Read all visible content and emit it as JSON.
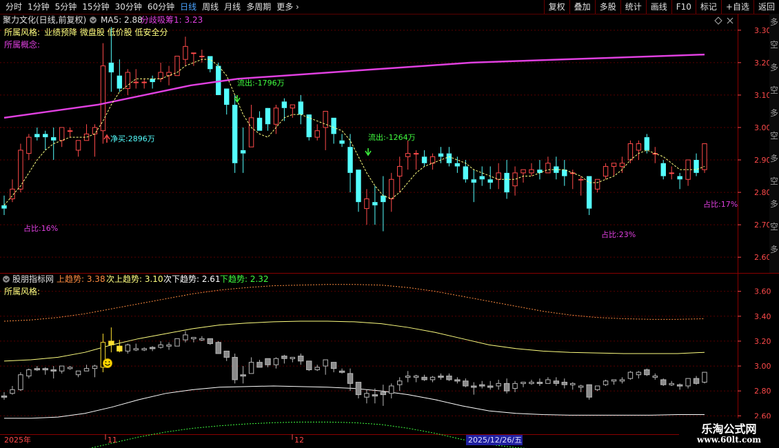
{
  "toolbar": {
    "periods": [
      "分时",
      "1分钟",
      "5分钟",
      "15分钟",
      "30分钟",
      "60分钟",
      "日线",
      "周线",
      "月线",
      "多周期",
      "更多"
    ],
    "active_period": "日线",
    "buttons": [
      "复权",
      "叠加",
      "多股",
      "统计",
      "画线",
      "F10",
      "标记",
      "+自选",
      "返回"
    ]
  },
  "main_panel": {
    "title": "聚力文化(日线,前复权)",
    "ma_label": "MA5: 2.88",
    "ind_label": "分歧吸筹1: 3.23",
    "style_label": "所属风格:",
    "style_value": "业绩预降 微盘股 低价股 低安全分",
    "concept_label": "所属概念:",
    "annotations": {
      "flow_out_1": "流出:-1796万",
      "flow_out_2": "流出:-1264万",
      "net_buy": "净买:2896万",
      "share_1": "占比:16%",
      "share_2": "占比:23%",
      "share_3": "占比:17%"
    },
    "y_ticks": [
      "3.30",
      "3.20",
      "3.10",
      "3.00",
      "2.90",
      "2.80",
      "2.70",
      "2.60"
    ],
    "side_chars": [
      "多",
      "空",
      "多",
      "空",
      "多",
      "空",
      "多",
      "空",
      "多",
      "空",
      "多"
    ],
    "diamond_icon": "diamond-icon",
    "close_icon": "close-icon"
  },
  "sub_panel": {
    "title": "股朋指标网",
    "up_label": "上趋势: 3.38",
    "sub_up_label": "次上趋势: 3.10",
    "sub_down_label": "次下趋势: 2.61",
    "down_label": "下趋势: 2.32",
    "style_label": "所属风格:",
    "y_ticks": [
      "3.60",
      "3.40",
      "3.20",
      "3.00",
      "2.80",
      "2.60"
    ],
    "smiley_icon": "smiley-icon"
  },
  "date_axis": {
    "labels": [
      "2025年",
      "11",
      "12",
      "2025/12/26/五"
    ]
  },
  "watermark": {
    "line1": "乐淘公式网",
    "line2": "www.60lt.com"
  },
  "colors": {
    "up": "#ff4a4a",
    "down": "#54ffff",
    "ma_long": "#e040e0",
    "ma5": "#ffff80",
    "grid": "#5a0000",
    "active": "#4aa3ff",
    "flow_out": "#40ff40",
    "net_buy": "#54ffff",
    "share": "#e040e0"
  },
  "chart_data": {
    "type": "candlestick",
    "y_range": [
      2.56,
      3.34
    ],
    "sub_y_range": [
      2.48,
      3.72
    ],
    "candles": [
      [
        2.76,
        2.75,
        2.79,
        2.73
      ],
      [
        2.78,
        2.81,
        2.84,
        2.77
      ],
      [
        2.81,
        2.93,
        2.95,
        2.8
      ],
      [
        2.92,
        2.97,
        2.98,
        2.9
      ],
      [
        2.98,
        2.97,
        3.0,
        2.96
      ],
      [
        2.98,
        2.97,
        2.99,
        2.93
      ],
      [
        2.97,
        2.96,
        3.0,
        2.9
      ],
      [
        2.96,
        3.0,
        3.0,
        2.94
      ],
      [
        2.99,
        2.99,
        3.0,
        2.97
      ],
      [
        2.93,
        2.96,
        2.96,
        2.91
      ],
      [
        2.96,
        2.98,
        3.01,
        2.96
      ],
      [
        2.98,
        3.0,
        3.01,
        2.91
      ],
      [
        2.99,
        3.19,
        3.26,
        2.95
      ],
      [
        3.2,
        3.17,
        3.31,
        3.11
      ],
      [
        3.16,
        3.12,
        3.21,
        3.11
      ],
      [
        3.12,
        3.17,
        3.18,
        3.1
      ],
      [
        3.14,
        3.14,
        3.18,
        3.12
      ],
      [
        3.14,
        3.14,
        3.15,
        3.12
      ],
      [
        3.15,
        3.14,
        3.16,
        3.12
      ],
      [
        3.15,
        3.17,
        3.2,
        3.14
      ],
      [
        3.16,
        3.17,
        3.19,
        3.13
      ],
      [
        3.16,
        3.22,
        3.22,
        3.16
      ],
      [
        3.21,
        3.25,
        3.28,
        3.19
      ],
      [
        3.23,
        3.23,
        3.23,
        3.19
      ],
      [
        3.22,
        3.22,
        3.24,
        3.2
      ],
      [
        3.22,
        3.18,
        3.21,
        3.17
      ],
      [
        3.19,
        3.1,
        3.2,
        3.1
      ],
      [
        3.12,
        3.07,
        3.12,
        3.04
      ],
      [
        3.07,
        2.89,
        3.1,
        2.86
      ],
      [
        2.93,
        2.92,
        3.0,
        2.86
      ],
      [
        2.94,
        3.03,
        3.07,
        2.95
      ],
      [
        3.03,
        2.99,
        3.05,
        2.99
      ],
      [
        3.06,
        3.01,
        3.02,
        2.99
      ],
      [
        3.01,
        3.06,
        3.07,
        2.98
      ],
      [
        3.08,
        3.06,
        3.09,
        3.02
      ],
      [
        3.06,
        3.07,
        3.07,
        3.03
      ],
      [
        3.08,
        3.04,
        3.1,
        3.01
      ],
      [
        3.04,
        2.97,
        3.03,
        2.96
      ],
      [
        2.97,
        2.99,
        3.01,
        2.96
      ],
      [
        3.0,
        3.05,
        3.05,
        2.93
      ],
      [
        3.03,
        2.98,
        3.03,
        2.95
      ],
      [
        2.96,
        2.95,
        2.98,
        2.94
      ],
      [
        2.94,
        2.86,
        2.98,
        2.8
      ],
      [
        2.87,
        2.77,
        2.87,
        2.74
      ],
      [
        2.75,
        2.78,
        2.81,
        2.7
      ],
      [
        2.77,
        2.76,
        2.82,
        2.7
      ],
      [
        2.79,
        2.77,
        2.85,
        2.68
      ],
      [
        2.78,
        2.84,
        2.86,
        2.74
      ],
      [
        2.85,
        2.88,
        2.91,
        2.8
      ],
      [
        2.91,
        2.92,
        2.96,
        2.87
      ],
      [
        2.92,
        2.92,
        2.93,
        2.87
      ],
      [
        2.91,
        2.89,
        2.93,
        2.88
      ],
      [
        2.89,
        2.91,
        2.92,
        2.87
      ],
      [
        2.92,
        2.91,
        2.94,
        2.89
      ],
      [
        2.92,
        2.89,
        2.94,
        2.88
      ],
      [
        2.89,
        2.88,
        2.91,
        2.86
      ],
      [
        2.88,
        2.84,
        2.9,
        2.83
      ],
      [
        2.84,
        2.83,
        2.87,
        2.77
      ],
      [
        2.85,
        2.84,
        2.88,
        2.82
      ],
      [
        2.84,
        2.83,
        2.88,
        2.81
      ],
      [
        2.84,
        2.86,
        2.89,
        2.81
      ],
      [
        2.86,
        2.8,
        2.9,
        2.78
      ],
      [
        2.82,
        2.86,
        2.88,
        2.79
      ],
      [
        2.86,
        2.87,
        2.87,
        2.83
      ],
      [
        2.86,
        2.87,
        2.89,
        2.85
      ],
      [
        2.87,
        2.86,
        2.9,
        2.84
      ],
      [
        2.86,
        2.89,
        2.91,
        2.86
      ],
      [
        2.88,
        2.86,
        2.91,
        2.84
      ],
      [
        2.87,
        2.85,
        2.9,
        2.82
      ],
      [
        2.86,
        2.86,
        2.87,
        2.81
      ],
      [
        2.84,
        2.84,
        2.85,
        2.79
      ],
      [
        2.85,
        2.75,
        2.85,
        2.73
      ],
      [
        2.81,
        2.84,
        2.84,
        2.8
      ],
      [
        2.85,
        2.88,
        2.89,
        2.84
      ],
      [
        2.88,
        2.89,
        2.89,
        2.85
      ],
      [
        2.88,
        2.89,
        2.91,
        2.86
      ],
      [
        2.9,
        2.95,
        2.96,
        2.89
      ],
      [
        2.93,
        2.95,
        2.96,
        2.9
      ],
      [
        2.97,
        2.93,
        2.98,
        2.92
      ],
      [
        2.92,
        2.92,
        2.94,
        2.89
      ],
      [
        2.89,
        2.85,
        2.9,
        2.84
      ],
      [
        2.86,
        2.86,
        2.88,
        2.84
      ],
      [
        2.85,
        2.84,
        2.86,
        2.81
      ],
      [
        2.84,
        2.9,
        2.9,
        2.82
      ],
      [
        2.9,
        2.86,
        2.92,
        2.85
      ],
      [
        2.87,
        2.95,
        2.95,
        2.86
      ]
    ],
    "ma_long": [
      3.03,
      3.05,
      3.07,
      3.1,
      3.13,
      3.15,
      3.16,
      3.17,
      3.18,
      3.19,
      3.2,
      3.205,
      3.21,
      3.215,
      3.22,
      3.225
    ],
    "ma5": [
      2.76,
      2.79,
      2.82,
      2.86,
      2.9,
      2.93,
      2.95,
      2.96,
      2.97,
      2.97,
      2.97,
      2.98,
      3.02,
      3.07,
      3.11,
      3.13,
      3.15,
      3.15,
      3.15,
      3.15,
      3.16,
      3.17,
      3.19,
      3.2,
      3.21,
      3.21,
      3.19,
      3.16,
      3.1,
      3.04,
      3.0,
      2.98,
      2.97,
      3.0,
      3.03,
      3.04,
      3.04,
      3.03,
      3.02,
      3.01,
      3.0,
      2.99,
      2.96,
      2.91,
      2.86,
      2.82,
      2.79,
      2.78,
      2.8,
      2.83,
      2.86,
      2.88,
      2.89,
      2.9,
      2.91,
      2.9,
      2.89,
      2.87,
      2.86,
      2.85,
      2.84,
      2.84,
      2.84,
      2.85,
      2.85,
      2.86,
      2.87,
      2.87,
      2.87,
      2.86,
      2.85,
      2.83,
      2.83,
      2.84,
      2.85,
      2.87,
      2.9,
      2.92,
      2.93,
      2.92,
      2.91,
      2.89,
      2.87,
      2.87,
      2.87,
      2.88
    ],
    "sub_up": [
      3.36,
      3.37,
      3.39,
      3.42,
      3.46,
      3.5,
      3.54,
      3.58,
      3.61,
      3.63,
      3.645,
      3.65,
      3.655,
      3.655,
      3.65,
      3.63,
      3.6,
      3.56,
      3.52,
      3.48,
      3.44,
      3.41,
      3.39,
      3.38,
      3.375,
      3.375,
      3.38
    ],
    "sub_mid_up": [
      3.04,
      3.05,
      3.07,
      3.11,
      3.17,
      3.22,
      3.26,
      3.3,
      3.33,
      3.345,
      3.355,
      3.36,
      3.36,
      3.355,
      3.34,
      3.31,
      3.27,
      3.22,
      3.17,
      3.14,
      3.12,
      3.11,
      3.105,
      3.1,
      3.1,
      3.1,
      3.11
    ],
    "sub_mid_down": [
      2.58,
      2.58,
      2.59,
      2.62,
      2.67,
      2.73,
      2.78,
      2.81,
      2.83,
      2.835,
      2.84,
      2.835,
      2.83,
      2.82,
      2.8,
      2.77,
      2.73,
      2.68,
      2.64,
      2.62,
      2.61,
      2.605,
      2.605,
      2.605,
      2.605,
      2.61,
      2.61
    ],
    "sub_down": [
      2.27,
      2.28,
      2.3,
      2.33,
      2.38,
      2.43,
      2.47,
      2.5,
      2.52,
      2.535,
      2.545,
      2.55,
      2.55,
      2.545,
      2.53,
      2.5,
      2.46,
      2.41,
      2.37,
      2.345,
      2.33,
      2.32,
      2.32,
      2.32,
      2.32,
      2.32,
      2.32
    ]
  }
}
